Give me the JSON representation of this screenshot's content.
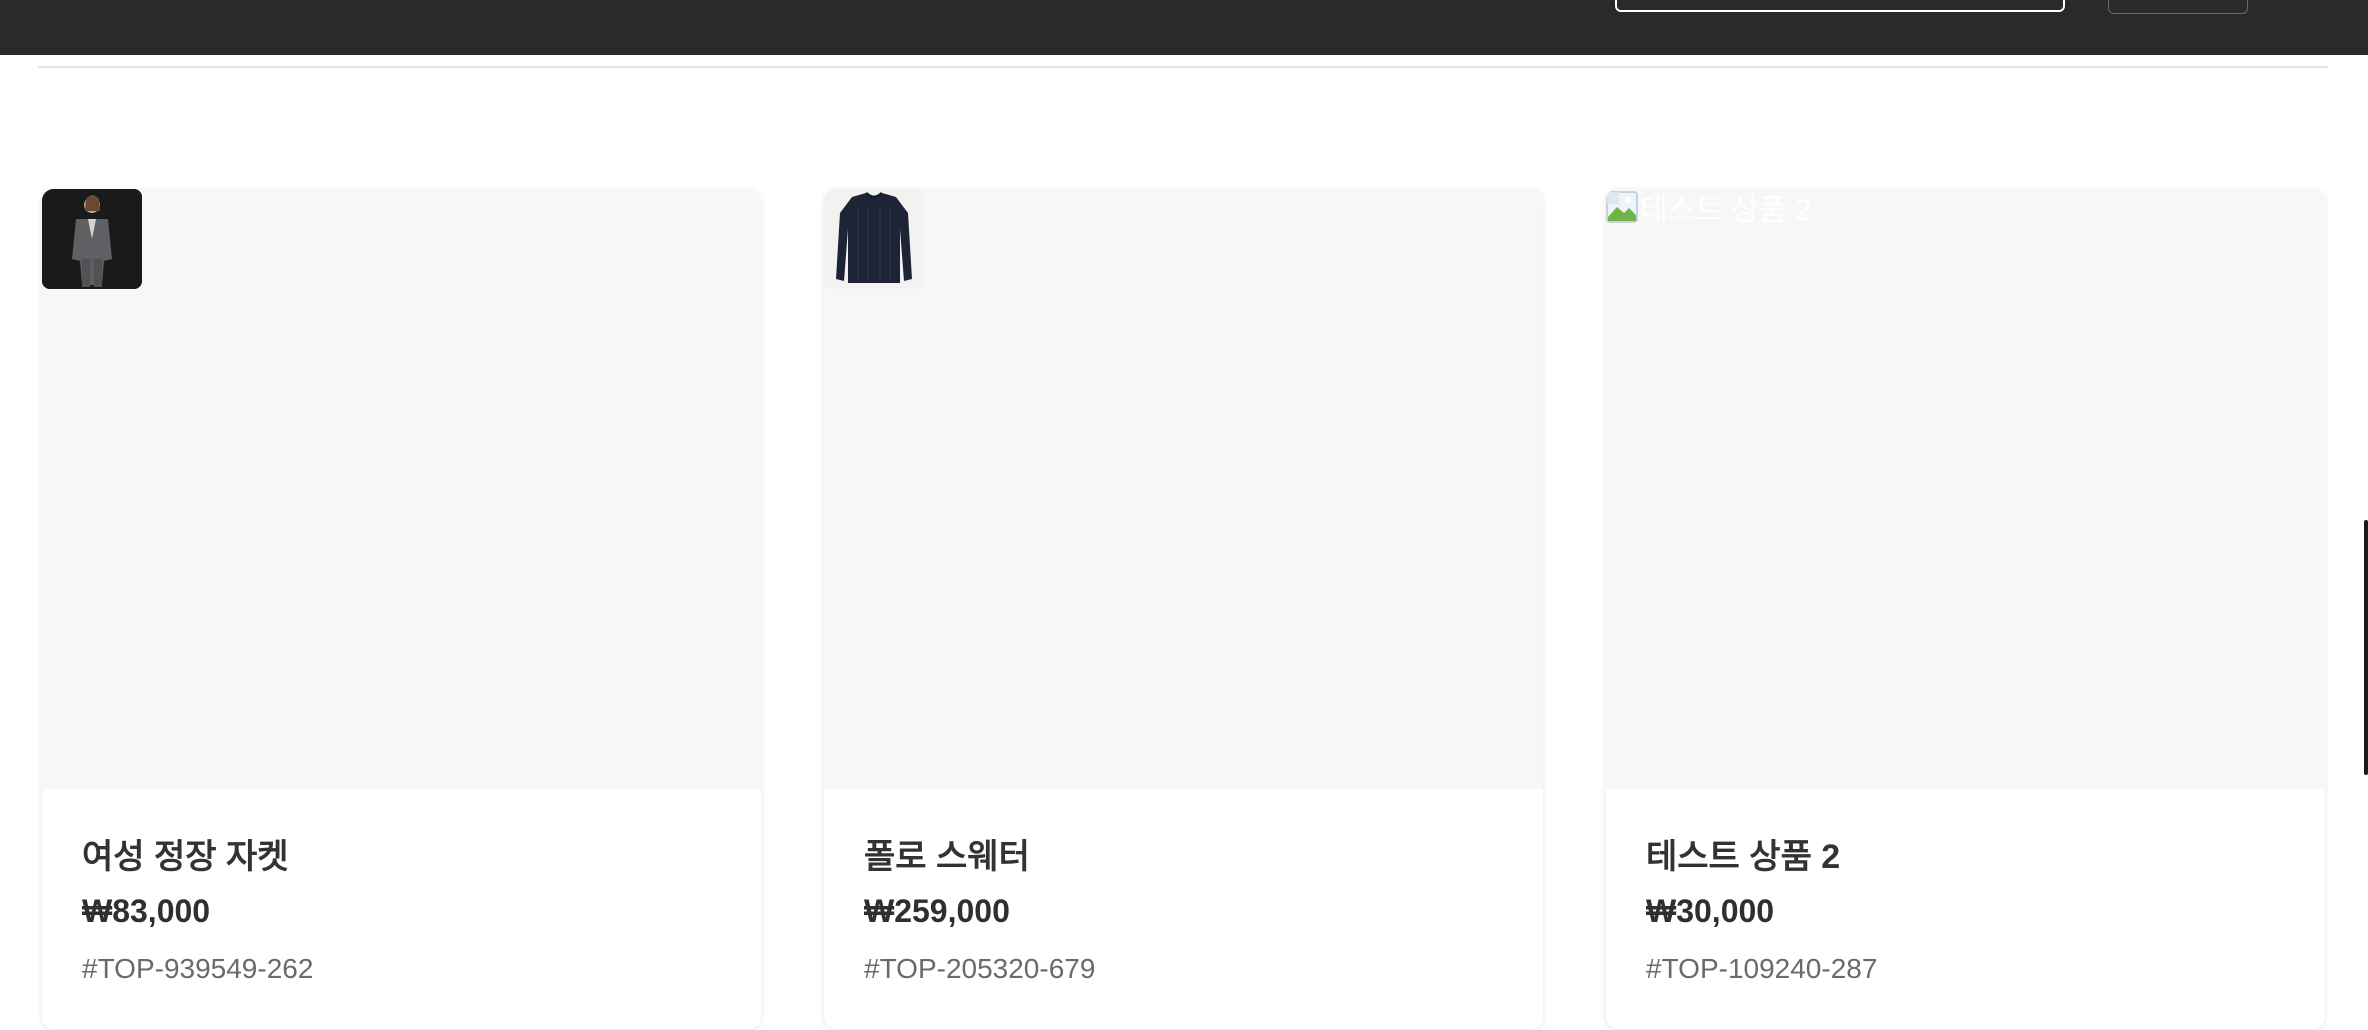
{
  "header": {
    "search_placeholder": ""
  },
  "products": [
    {
      "name": "여성 정장 자켓",
      "price": "₩83,000",
      "code": "#TOP-939549-262",
      "image": "jacket-photo"
    },
    {
      "name": "폴로 스웨터",
      "price": "₩259,000",
      "code": "#TOP-205320-679",
      "image": "sweater-photo"
    },
    {
      "name": "테스트 상품 2",
      "price": "₩30,000",
      "code": "#TOP-109240-287",
      "image_alt": "테스트 상품 2"
    }
  ],
  "colors": {
    "topbar": "#2a2a2a",
    "card_image_bg": "#f7f7f7",
    "title": "#333333",
    "code": "#6a6a6a"
  }
}
